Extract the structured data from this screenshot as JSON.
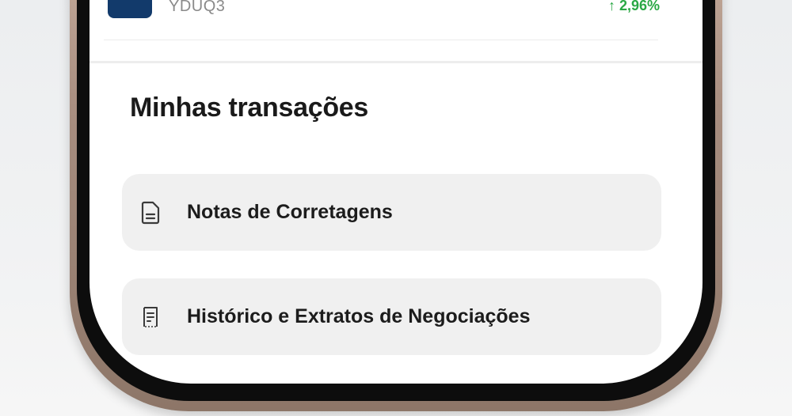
{
  "stock_row": {
    "ticker": "YDUQ3",
    "change": "↑ 2,96%",
    "change_color": "#2aa845",
    "logo_color": "#123a6b",
    "icon": "arrow-up-icon"
  },
  "transactions": {
    "title": "Minhas transações",
    "items": [
      {
        "label": "Notas de Corretagens",
        "icon": "document-icon"
      },
      {
        "label": "Histórico e Extratos de Negociações",
        "icon": "receipt-icon"
      }
    ]
  }
}
